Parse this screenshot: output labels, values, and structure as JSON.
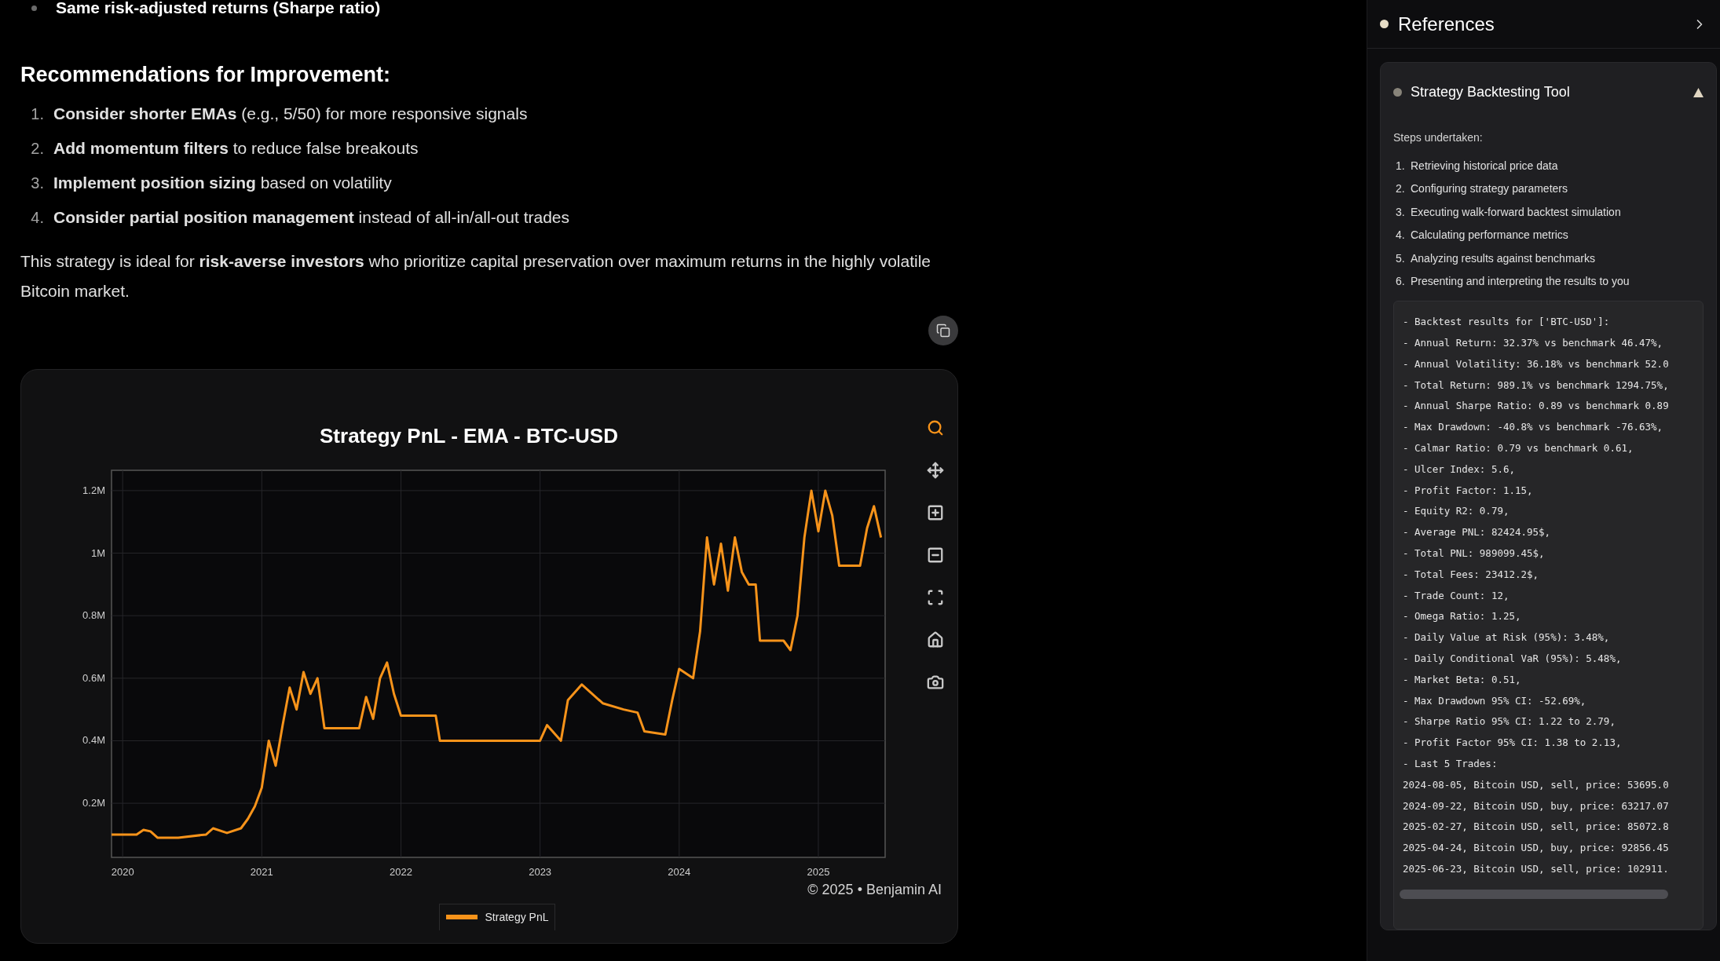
{
  "main": {
    "bullets": [
      {
        "text": "Same risk-adjusted returns (Sharpe ratio)"
      }
    ],
    "heading": "Recommendations for Improvement:",
    "recommendations": [
      {
        "number": "1.",
        "text": "**Consider shorter EMAs** (e.g., 5/50) for more responsive signals"
      },
      {
        "number": "2.",
        "text": "**Add momentum filters** to reduce false breakouts"
      },
      {
        "number": "3.",
        "text": "**Implement position sizing** based on volatility"
      },
      {
        "number": "4.",
        "text": "**Consider partial position management** instead of all-in/all-out trades"
      }
    ],
    "paragraph": "This strategy is ideal for **risk-averse investors** who prioritize capital preservation over maximum returns in the highly volatile Bitcoin market.",
    "chart_card": {
      "modebar": [
        {
          "kind": "zoom",
          "selected": true
        },
        {
          "kind": "pan",
          "selected": false
        },
        {
          "kind": "zoom_in",
          "selected": false
        },
        {
          "kind": "zoom_out",
          "selected": false
        },
        {
          "kind": "autoscale",
          "selected": false
        },
        {
          "kind": "reset",
          "selected": false
        },
        {
          "kind": "snapshot",
          "selected": false
        }
      ],
      "watermark": "© 2025 • Benjamin AI",
      "chart_data": {
        "type": "line",
        "title": "Strategy PnL - EMA - BTC-USD",
        "x": [
          2019.92,
          2020.1,
          2020.15,
          2020.2,
          2020.25,
          2020.4,
          2020.6,
          2020.65,
          2020.75,
          2020.85,
          2020.9,
          2020.95,
          2021.0,
          2021.05,
          2021.1,
          2021.15,
          2021.2,
          2021.25,
          2021.3,
          2021.35,
          2021.4,
          2021.45,
          2021.6,
          2021.7,
          2021.75,
          2021.8,
          2021.85,
          2021.9,
          2021.95,
          2022.0,
          2022.25,
          2022.28,
          2022.5,
          2023.0,
          2023.05,
          2023.15,
          2023.2,
          2023.3,
          2023.45,
          2023.6,
          2023.7,
          2023.75,
          2023.9,
          2023.95,
          2024.0,
          2024.1,
          2024.15,
          2024.2,
          2024.25,
          2024.3,
          2024.35,
          2024.4,
          2024.45,
          2024.5,
          2024.55,
          2024.58,
          2024.75,
          2024.8,
          2024.85,
          2024.9,
          2024.95,
          2025.0,
          2025.05,
          2025.1,
          2025.15,
          2025.3,
          2025.35,
          2025.4,
          2025.45
        ],
        "series": [
          {
            "name": "Strategy PnL",
            "color": "#f7931a",
            "values": [
              0.1,
              0.1,
              0.115,
              0.11,
              0.09,
              0.09,
              0.1,
              0.12,
              0.105,
              0.12,
              0.15,
              0.19,
              0.25,
              0.4,
              0.32,
              0.45,
              0.57,
              0.5,
              0.62,
              0.55,
              0.6,
              0.44,
              0.44,
              0.44,
              0.54,
              0.47,
              0.6,
              0.65,
              0.55,
              0.48,
              0.48,
              0.4,
              0.4,
              0.4,
              0.45,
              0.4,
              0.53,
              0.58,
              0.52,
              0.5,
              0.49,
              0.43,
              0.42,
              0.53,
              0.63,
              0.6,
              0.75,
              1.05,
              0.9,
              1.03,
              0.88,
              1.05,
              0.94,
              0.9,
              0.9,
              0.72,
              0.72,
              0.69,
              0.8,
              1.05,
              1.2,
              1.07,
              1.2,
              1.12,
              0.96,
              0.96,
              1.08,
              1.15,
              1.05
            ]
          }
        ],
        "grid": true,
        "xlim": [
          2019.92,
          2025.48
        ],
        "ylim": [
          0.027,
          1.265
        ],
        "xticks": [
          {
            "value": 2020,
            "label": "2020"
          },
          {
            "value": 2021,
            "label": "2021"
          },
          {
            "value": 2022,
            "label": "2022"
          },
          {
            "value": 2023,
            "label": "2023"
          },
          {
            "value": 2024,
            "label": "2024"
          },
          {
            "value": 2025,
            "label": "2025"
          }
        ],
        "yticks": [
          {
            "value": 0.2,
            "label": "0.2M"
          },
          {
            "value": 0.4,
            "label": "0.4M"
          },
          {
            "value": 0.6,
            "label": "0.6M"
          },
          {
            "value": 0.8,
            "label": "0.8M"
          },
          {
            "value": 1.0,
            "label": "1M"
          },
          {
            "value": 1.2,
            "label": "1.2M"
          }
        ]
      }
    }
  },
  "references": {
    "title": "References",
    "tool": {
      "title": "Strategy Backtesting Tool",
      "expanded": true,
      "steps_label": "Steps undertaken:",
      "steps": [
        {
          "number": "1.",
          "text": "Retrieving historical price data"
        },
        {
          "number": "2.",
          "text": "Configuring strategy parameters"
        },
        {
          "number": "3.",
          "text": "Executing walk-forward backtest simulation"
        },
        {
          "number": "4.",
          "text": "Calculating performance metrics"
        },
        {
          "number": "5.",
          "text": "Analyzing results against benchmarks"
        },
        {
          "number": "6.",
          "text": "Presenting and interpreting the results to you"
        }
      ],
      "output_lines": [
        "- Backtest results for ['BTC-USD']:",
        "- Annual Return: 32.37% vs benchmark 46.47%,",
        "- Annual Volatility: 36.18% vs benchmark 52.0",
        "- Total Return: 989.1% vs benchmark 1294.75%,",
        "- Annual Sharpe Ratio: 0.89 vs benchmark 0.89",
        "- Max Drawdown: -40.8% vs benchmark -76.63%,",
        "- Calmar Ratio: 0.79 vs benchmark 0.61,",
        "- Ulcer Index: 5.6,",
        "- Profit Factor: 1.15,",
        "- Equity R2: 0.79,",
        "- Average PNL: 82424.95$,",
        "- Total PNL: 989099.45$,",
        "- Total Fees: 23412.2$,",
        "- Trade Count: 12,",
        "- Omega Ratio: 1.25,",
        "- Daily Value at Risk (95%): 3.48%,",
        "- Daily Conditional VaR (95%): 5.48%,",
        "- Market Beta: 0.51,",
        "- Max Drawdown 95% CI: -52.69%,",
        "- Sharpe Ratio 95% CI: 1.22 to 2.79,",
        "- Profit Factor 95% CI: 1.38 to 2.13,",
        "- Last 5 Trades:",
        "2024-08-05, Bitcoin USD, sell, price: 53695.0",
        "2024-09-22, Bitcoin USD, buy, price: 63217.07",
        "2025-02-27, Bitcoin USD, sell, price: 85072.8",
        "2025-04-24, Bitcoin USD, buy, price: 92856.45",
        "2025-06-23, Bitcoin USD, sell, price: 102911."
      ]
    }
  }
}
